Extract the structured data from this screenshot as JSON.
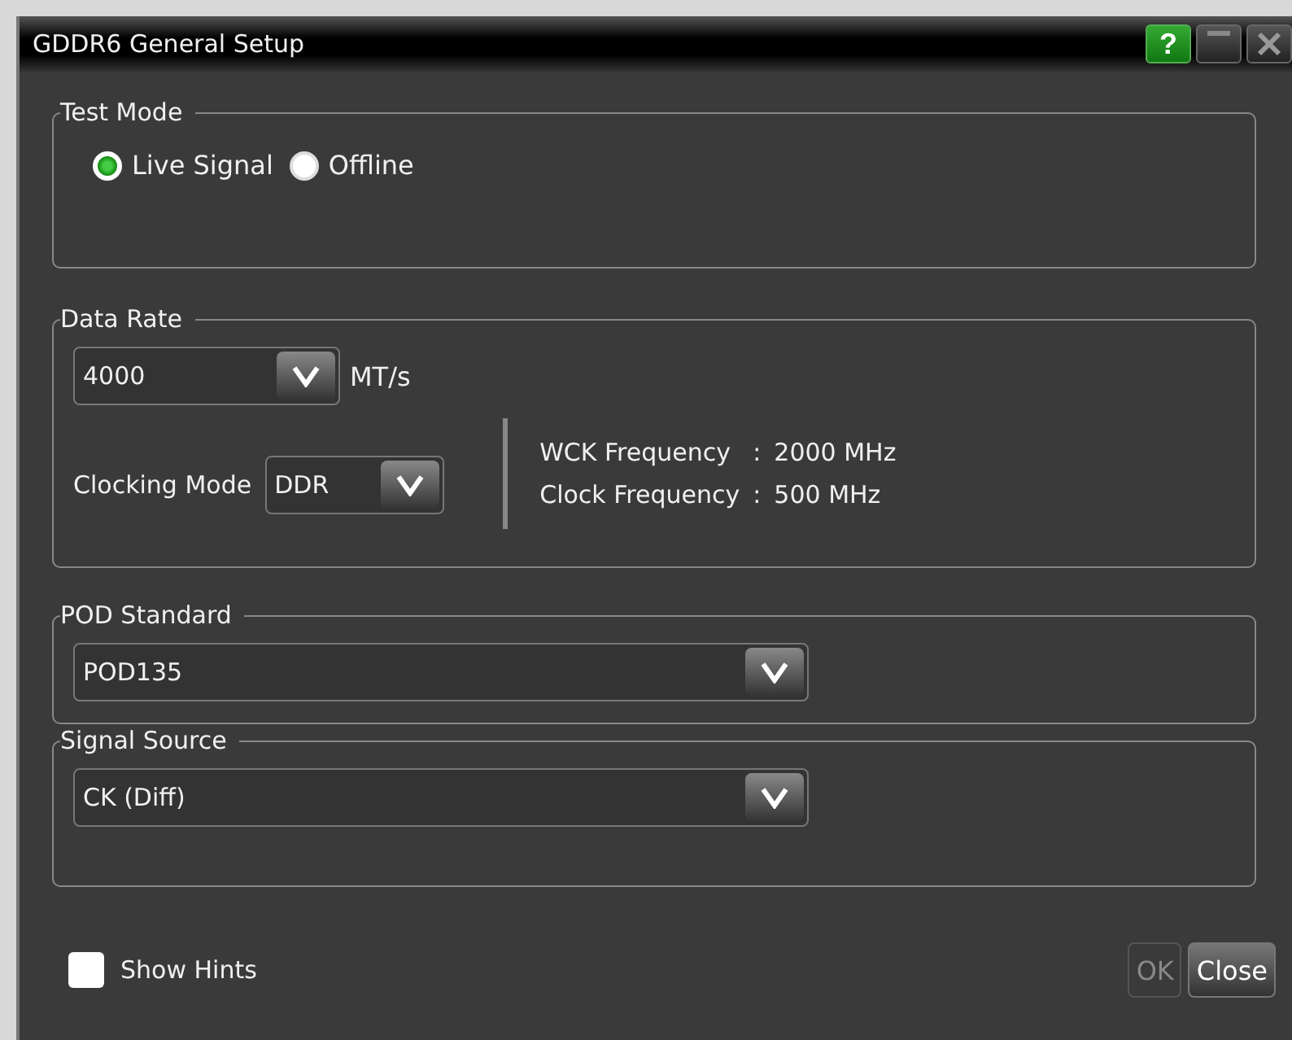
{
  "window": {
    "title": "GDDR6 General Setup",
    "help": "?"
  },
  "test_mode": {
    "label": "Test Mode",
    "options": [
      {
        "label": "Live Signal",
        "selected": true
      },
      {
        "label": "Offline",
        "selected": false
      }
    ]
  },
  "data_rate": {
    "label": "Data Rate",
    "value": "4000",
    "unit": "MT/s",
    "clocking_label": "Clocking Mode",
    "clocking_value": "DDR",
    "info": [
      {
        "label": "WCK Frequency",
        "sep": ":",
        "value": "2000 MHz"
      },
      {
        "label": "Clock Frequency",
        "sep": ":",
        "value": "500 MHz"
      }
    ]
  },
  "pod_standard": {
    "label": "POD Standard",
    "value": "POD135"
  },
  "signal_source": {
    "label": "Signal Source",
    "value": "CK (Diff)"
  },
  "show_hints": {
    "label": "Show Hints",
    "checked": false
  },
  "buttons": [
    {
      "label": "OK",
      "disabled": true
    },
    {
      "label": "Close",
      "disabled": false
    }
  ]
}
